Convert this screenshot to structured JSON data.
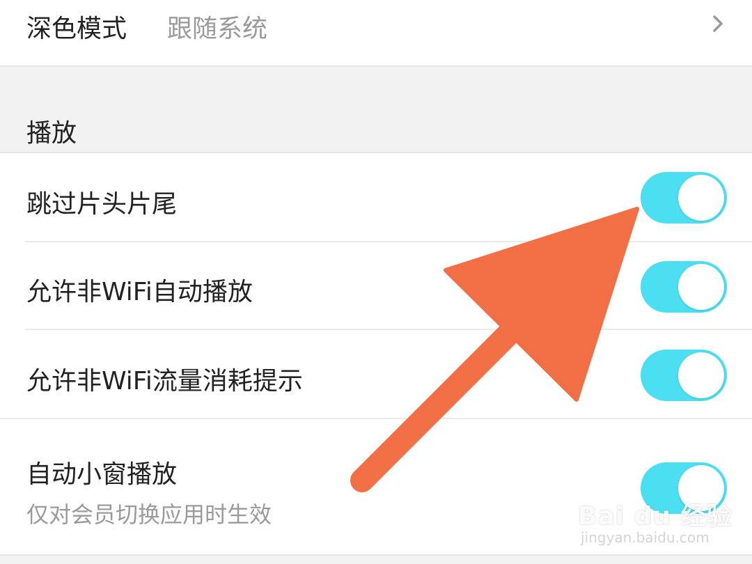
{
  "settings": {
    "dark_mode": {
      "label": "深色模式",
      "value": "跟随系统"
    },
    "playback_section": {
      "title": "播放",
      "items": [
        {
          "label": "跳过片头片尾",
          "enabled": true
        },
        {
          "label": "允许非WiFi自动播放",
          "enabled": true
        },
        {
          "label": "允许非WiFi流量消耗提示",
          "enabled": true
        },
        {
          "label": "自动小窗播放",
          "sublabel": "仅对会员切换应用时生效",
          "enabled": true
        }
      ]
    }
  },
  "annotation": {
    "arrow_color": "#f26e44"
  },
  "watermark": {
    "brand": "Bai du 经验",
    "url": "jingyan.baidu.com"
  },
  "colors": {
    "toggle_on": "#4cdff2",
    "section_bg": "#f2f2f2"
  },
  "icons": {
    "chevron": "chevron-right-icon",
    "arrow": "pointer-arrow-icon"
  }
}
